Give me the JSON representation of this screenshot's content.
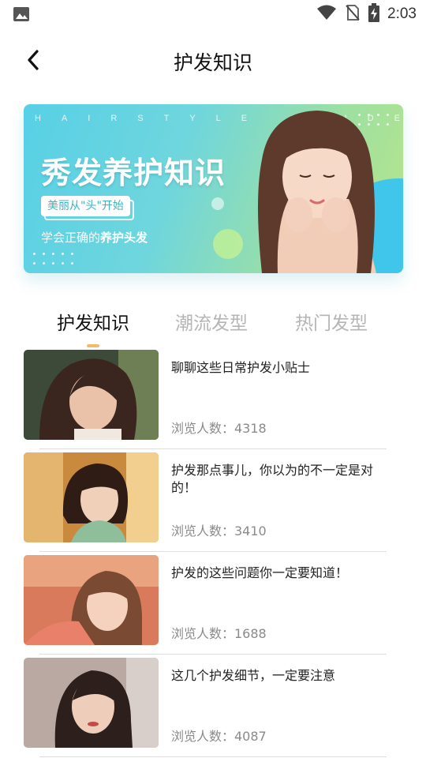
{
  "status_bar": {
    "time": "2:03",
    "icons": [
      "image-icon",
      "wifi-icon",
      "no-sim-icon",
      "battery-charging-icon"
    ]
  },
  "header": {
    "title": "护发知识",
    "back_icon": "chevron-left-icon"
  },
  "banner": {
    "deco_text": "HAIRSTYLE GUIDE",
    "title": "秀发养护知识",
    "tag": "美丽从\"头\"开始",
    "subtitle_prefix": "学会正确的",
    "subtitle_bold": "养护头发",
    "colors": {
      "gradient_start": "#57d0e6",
      "gradient_end": "#b7e58a",
      "accent": "#3fc6ea"
    }
  },
  "tabs": [
    {
      "label": "护发知识",
      "active": true
    },
    {
      "label": "潮流发型",
      "active": false
    },
    {
      "label": "热门发型",
      "active": false
    }
  ],
  "articles": [
    {
      "title": "聊聊这些日常护发小贴士",
      "views": "浏览人数：4318"
    },
    {
      "title": "护发那点事儿，你以为的不一定是对的！",
      "views": "浏览人数：3410"
    },
    {
      "title": "护发的这些问题你一定要知道！",
      "views": "浏览人数：1688"
    },
    {
      "title": "这几个护发细节，一定要注意",
      "views": "浏览人数：4087"
    }
  ],
  "colors": {
    "tab_indicator": "#f5b96a",
    "muted_text": "#8a8a8a",
    "inactive_tab": "#b5b5b5"
  }
}
